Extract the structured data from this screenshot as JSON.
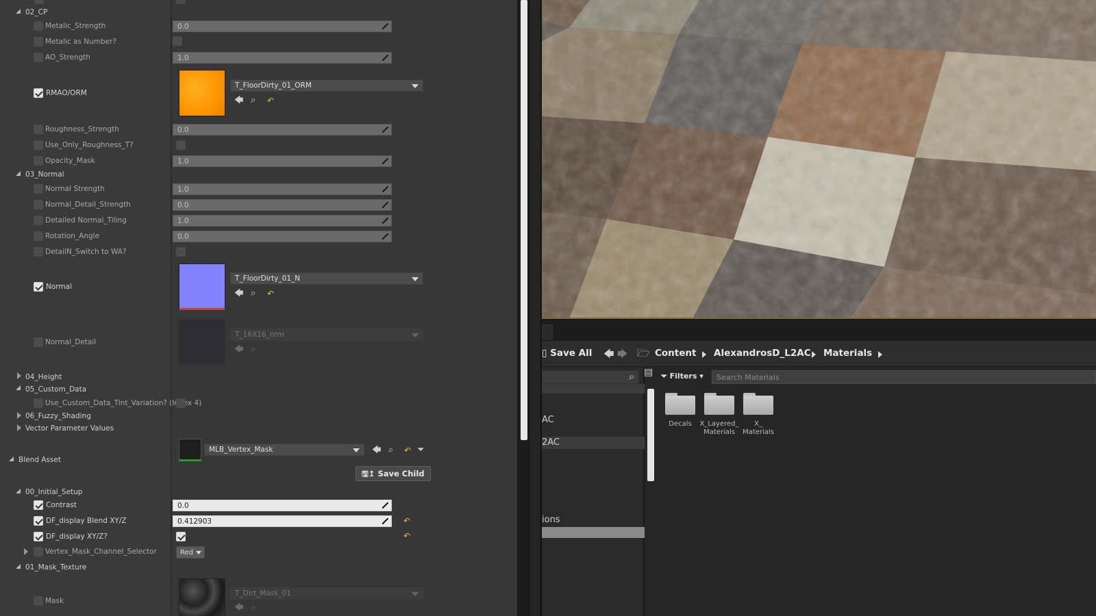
{
  "details": {
    "groups": {
      "cp": "02_CP",
      "normal": "03_Normal",
      "height": "04_Height",
      "custom": "05_Custom_Data",
      "fuzzy": "06_Fuzzy_Shading",
      "vector": "Vector Parameter Values",
      "blend_asset": "Blend Asset",
      "initial_setup": "00_Initial_Setup",
      "mask_texture": "01_Mask_Texture"
    },
    "params": {
      "metalic_strength": {
        "label": "Metalic_Strength",
        "value": "0.0"
      },
      "metalic_number": {
        "label": "Metalic as Number?"
      },
      "ao_strength": {
        "label": "AO_Strength",
        "value": "1.0"
      },
      "rmao": {
        "label": "RMAO/ORM",
        "texture": "T_FloorDirty_01_ORM"
      },
      "roughness_strength": {
        "label": "Roughness_Strength",
        "value": "0.0"
      },
      "use_only_roughness": {
        "label": "Use_Only_Roughness_T?"
      },
      "opacity_mask": {
        "label": "Opacity_Mask",
        "value": "1.0"
      },
      "normal_strength": {
        "label": "Normal Strength",
        "value": "1.0"
      },
      "normal_detail_strength": {
        "label": "Normal_Detail_Strength",
        "value": "0.0"
      },
      "detailed_normal_tiling": {
        "label": "Detailed Normal_Tiling",
        "value": "1.0"
      },
      "rotation_angle": {
        "label": "Rotation_Angle",
        "value": "0.0"
      },
      "detailn_switch": {
        "label": "DetailN_Switch to WA?"
      },
      "normal": {
        "label": "Normal",
        "texture": "T_FloorDirty_01_N"
      },
      "normal_detail": {
        "label": "Normal_Detail",
        "texture": "T_16X16_nrm"
      },
      "use_custom_tint": {
        "label": "Use_Custom_Data_Tint_Variation? (Index 4)"
      },
      "blend_asset_value": "MLB_Vertex_Mask",
      "save_child": "Save Child",
      "contrast": {
        "label": "Contrast",
        "value": "0.0"
      },
      "df_blend": {
        "label": "DF_display Blend XY/Z",
        "value": "0.412903"
      },
      "df_xyz": {
        "label": "DF_display XY/Z?"
      },
      "vertex_mask_channel": {
        "label": "Vertex_Mask_Channel_Selector",
        "value": "Red"
      },
      "mask": {
        "label": "Mask",
        "texture": "T_Dirt_Mask_01"
      }
    },
    "colors": {
      "orm": "#ff9e0a",
      "normal": "#8080ff"
    }
  },
  "content_browser": {
    "save_all": "Save All",
    "breadcrumbs": [
      "Content",
      "AlexandrosD_L2AC",
      "Materials"
    ],
    "filters": "Filters",
    "search_placeholder": "Search Materials",
    "tree_items": [
      "AC",
      "2AC",
      "ions"
    ],
    "folders": [
      {
        "line1": "Decals",
        "line2": ""
      },
      {
        "line1": "X_Layered_",
        "line2": "Materials"
      },
      {
        "line1": "X_",
        "line2": "Materials"
      }
    ]
  }
}
